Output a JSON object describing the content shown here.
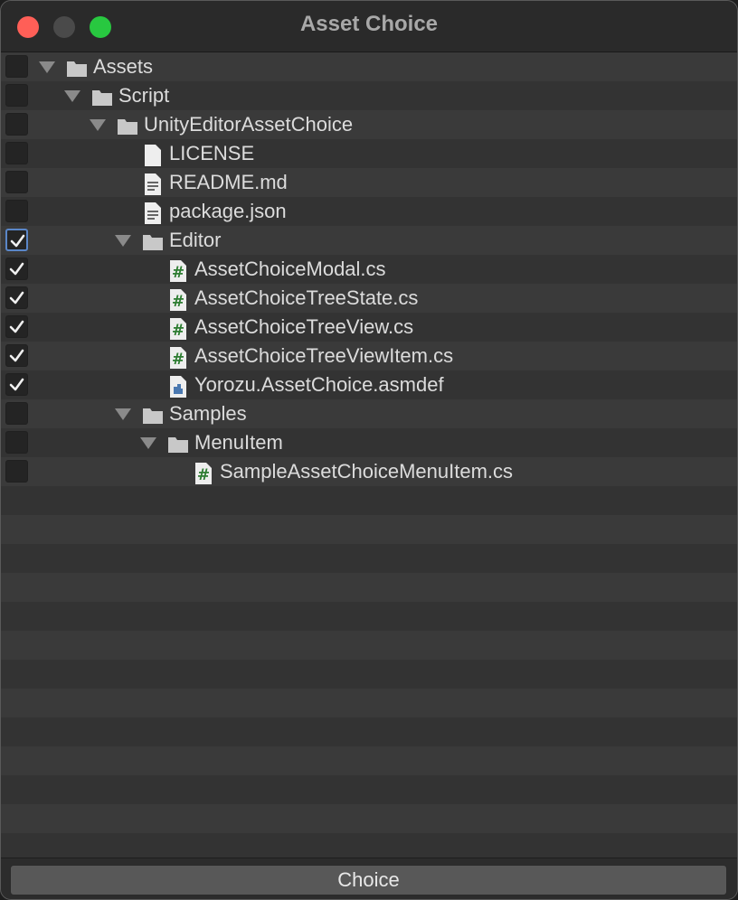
{
  "window": {
    "title": "Asset Choice"
  },
  "tree": {
    "items": [
      {
        "label": "Assets",
        "depth": 0,
        "type": "folder",
        "expanded": true,
        "checked": false,
        "focused": false,
        "icon": "folder-icon"
      },
      {
        "label": "Script",
        "depth": 1,
        "type": "folder",
        "expanded": true,
        "checked": false,
        "focused": false,
        "icon": "folder-icon"
      },
      {
        "label": "UnityEditorAssetChoice",
        "depth": 2,
        "type": "folder",
        "expanded": true,
        "checked": false,
        "focused": false,
        "icon": "folder-icon"
      },
      {
        "label": "LICENSE",
        "depth": 3,
        "type": "file",
        "checked": false,
        "focused": false,
        "icon": "blank-file-icon"
      },
      {
        "label": "README.md",
        "depth": 3,
        "type": "file",
        "checked": false,
        "focused": false,
        "icon": "text-file-icon"
      },
      {
        "label": "package.json",
        "depth": 3,
        "type": "file",
        "checked": false,
        "focused": false,
        "icon": "text-file-icon"
      },
      {
        "label": "Editor",
        "depth": 3,
        "type": "folder",
        "expanded": true,
        "checked": true,
        "focused": true,
        "icon": "folder-icon"
      },
      {
        "label": "AssetChoiceModal.cs",
        "depth": 4,
        "type": "file",
        "checked": true,
        "focused": false,
        "icon": "csharp-script-icon"
      },
      {
        "label": "AssetChoiceTreeState.cs",
        "depth": 4,
        "type": "file",
        "checked": true,
        "focused": false,
        "icon": "csharp-script-icon"
      },
      {
        "label": "AssetChoiceTreeView.cs",
        "depth": 4,
        "type": "file",
        "checked": true,
        "focused": false,
        "icon": "csharp-script-icon"
      },
      {
        "label": "AssetChoiceTreeViewItem.cs",
        "depth": 4,
        "type": "file",
        "checked": true,
        "focused": false,
        "icon": "csharp-script-icon"
      },
      {
        "label": "Yorozu.AssetChoice.asmdef",
        "depth": 4,
        "type": "file",
        "checked": true,
        "focused": false,
        "icon": "assembly-definition-icon"
      },
      {
        "label": "Samples",
        "depth": 3,
        "type": "folder",
        "expanded": true,
        "checked": false,
        "focused": false,
        "icon": "folder-icon"
      },
      {
        "label": "MenuItem",
        "depth": 4,
        "type": "folder",
        "expanded": true,
        "checked": false,
        "focused": false,
        "icon": "folder-icon"
      },
      {
        "label": "SampleAssetChoiceMenuItem.cs",
        "depth": 5,
        "type": "file",
        "checked": false,
        "focused": false,
        "icon": "csharp-script-icon"
      }
    ]
  },
  "footer": {
    "choice_label": "Choice"
  },
  "colors": {
    "close": "#ff5f57",
    "minimize": "#4a4a4a",
    "maximize": "#28c840",
    "focus_ring": "#5a86c8",
    "script_hash": "#2e7d32"
  }
}
